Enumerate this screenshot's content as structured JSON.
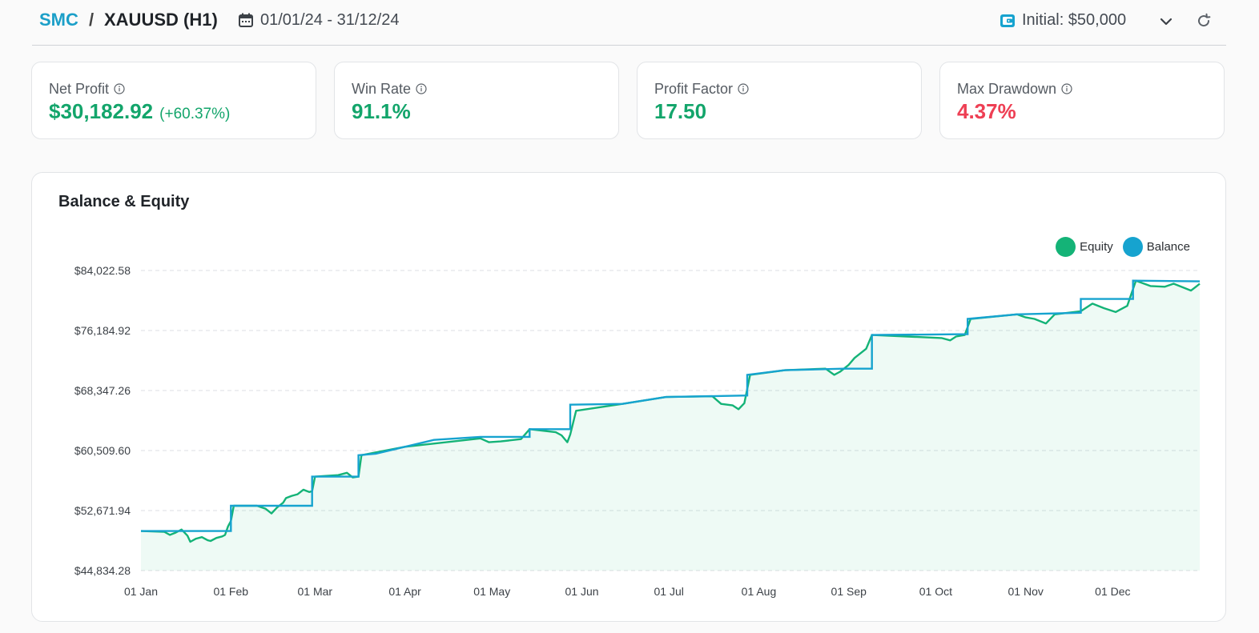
{
  "header": {
    "strategy": "SMC",
    "separator": "/",
    "symbol": "XAUUSD (H1)",
    "date_range": "01/01/24 - 31/12/24",
    "initial": "Initial: $50,000",
    "icons": {
      "calendar": "calendar-icon",
      "wallet": "wallet-icon",
      "dropdown": "chevron-down-icon",
      "refresh": "refresh-icon"
    }
  },
  "stats": [
    {
      "title": "Net Profit",
      "value": "$30,182.92",
      "sub": "(+60.37%)",
      "color": "#13a56b"
    },
    {
      "title": "Win Rate",
      "value": "91.1%",
      "sub": "",
      "color": "#13a56b"
    },
    {
      "title": "Profit Factor",
      "value": "17.50",
      "sub": "",
      "color": "#13a56b"
    },
    {
      "title": "Max Drawdown",
      "value": "4.37%",
      "sub": "",
      "color": "#ee3f54"
    }
  ],
  "chart": {
    "title": "Balance & Equity",
    "legend": [
      {
        "name": "Equity",
        "color": "#14b377"
      },
      {
        "name": "Balance",
        "color": "#16a3cf"
      }
    ]
  },
  "chart_data": {
    "type": "line",
    "title": "Balance & Equity",
    "y_ticks": [
      "$44,834.28",
      "$52,671.94",
      "$60,509.60",
      "$68,347.26",
      "$76,184.92",
      "$84,022.58"
    ],
    "ylim": [
      44834.28,
      84022.58
    ],
    "x_ticks": [
      "01 Jan",
      "01 Feb",
      "01 Mar",
      "01 Apr",
      "01 May",
      "01 Jun",
      "01 Jul",
      "01 Aug",
      "01 Sep",
      "01 Oct",
      "01 Nov",
      "01 Dec"
    ],
    "x_domain_days": [
      0,
      365
    ],
    "grid": true,
    "legend_position": "top-right",
    "series": [
      {
        "name": "Balance",
        "color": "#16a3cf",
        "step": true,
        "points": [
          [
            0,
            50000
          ],
          [
            31,
            50000
          ],
          [
            31,
            53300
          ],
          [
            59,
            53300
          ],
          [
            59,
            57100
          ],
          [
            75,
            57100
          ],
          [
            75,
            59900
          ],
          [
            81,
            60100
          ],
          [
            91,
            61000
          ],
          [
            101,
            61900
          ],
          [
            117,
            62300
          ],
          [
            134,
            62300
          ],
          [
            134,
            63300
          ],
          [
            148,
            63300
          ],
          [
            148,
            66500
          ],
          [
            166,
            66600
          ],
          [
            181,
            67500
          ],
          [
            209,
            67700
          ],
          [
            209,
            70400
          ],
          [
            222,
            71000
          ],
          [
            242,
            71200
          ],
          [
            252,
            71200
          ],
          [
            252,
            75600
          ],
          [
            285,
            75700
          ],
          [
            285,
            77700
          ],
          [
            302,
            78300
          ],
          [
            324,
            78500
          ],
          [
            324,
            80300
          ],
          [
            342,
            80300
          ],
          [
            342,
            82700
          ],
          [
            365,
            82600
          ]
        ]
      },
      {
        "name": "Equity",
        "color": "#14b377",
        "points": [
          [
            0,
            50000
          ],
          [
            8,
            49900
          ],
          [
            10,
            49500
          ],
          [
            12,
            49800
          ],
          [
            14,
            50200
          ],
          [
            16,
            49400
          ],
          [
            17,
            48600
          ],
          [
            19,
            49000
          ],
          [
            21,
            49200
          ],
          [
            23,
            48800
          ],
          [
            24,
            48700
          ],
          [
            26,
            49100
          ],
          [
            28,
            49300
          ],
          [
            29,
            49500
          ],
          [
            30,
            50600
          ],
          [
            31,
            51300
          ],
          [
            32,
            53300
          ],
          [
            40,
            53300
          ],
          [
            43,
            52900
          ],
          [
            45,
            52300
          ],
          [
            47,
            53100
          ],
          [
            49,
            53700
          ],
          [
            50,
            54300
          ],
          [
            52,
            54600
          ],
          [
            54,
            54800
          ],
          [
            56,
            55400
          ],
          [
            58,
            55100
          ],
          [
            59,
            55200
          ],
          [
            60,
            57100
          ],
          [
            68,
            57300
          ],
          [
            71,
            57600
          ],
          [
            73,
            57000
          ],
          [
            75,
            57100
          ],
          [
            76,
            59900
          ],
          [
            91,
            61000
          ],
          [
            117,
            62100
          ],
          [
            120,
            61600
          ],
          [
            124,
            61700
          ],
          [
            131,
            62000
          ],
          [
            134,
            63300
          ],
          [
            143,
            62900
          ],
          [
            145,
            62500
          ],
          [
            147,
            61600
          ],
          [
            148,
            62600
          ],
          [
            150,
            65700
          ],
          [
            166,
            66600
          ],
          [
            181,
            67500
          ],
          [
            197,
            67600
          ],
          [
            200,
            66600
          ],
          [
            204,
            66400
          ],
          [
            206,
            65900
          ],
          [
            208,
            66700
          ],
          [
            210,
            70400
          ],
          [
            222,
            71000
          ],
          [
            236,
            71200
          ],
          [
            239,
            70400
          ],
          [
            241,
            70800
          ],
          [
            244,
            71700
          ],
          [
            246,
            72600
          ],
          [
            250,
            73800
          ],
          [
            252,
            75600
          ],
          [
            276,
            75200
          ],
          [
            279,
            74900
          ],
          [
            281,
            75400
          ],
          [
            284,
            75600
          ],
          [
            286,
            77700
          ],
          [
            302,
            78300
          ],
          [
            305,
            77900
          ],
          [
            308,
            77700
          ],
          [
            312,
            77100
          ],
          [
            315,
            78300
          ],
          [
            324,
            78700
          ],
          [
            328,
            79700
          ],
          [
            332,
            79100
          ],
          [
            336,
            78600
          ],
          [
            340,
            79400
          ],
          [
            343,
            82700
          ],
          [
            348,
            82000
          ],
          [
            353,
            81900
          ],
          [
            356,
            82300
          ],
          [
            360,
            81700
          ],
          [
            362,
            81400
          ],
          [
            364,
            82000
          ],
          [
            365,
            82300
          ]
        ]
      }
    ]
  }
}
